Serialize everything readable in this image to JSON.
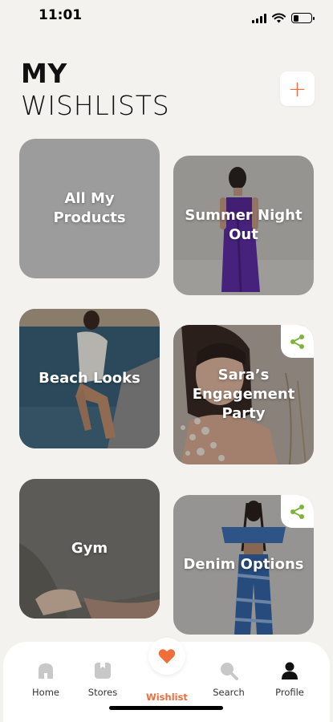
{
  "status": {
    "time": "11:01",
    "battery_level": 0.3
  },
  "header": {
    "title_line1": "MY",
    "title_line2": "WISHLISTS",
    "add_label": "+"
  },
  "cards": [
    {
      "label": "All My Products"
    },
    {
      "label": "Summer Night Out"
    },
    {
      "label": "Beach Looks"
    },
    {
      "label": "Sara’s Engagement Party"
    },
    {
      "label": "Gym"
    },
    {
      "label": "Denim Options"
    }
  ],
  "nav": {
    "home": "Home",
    "stores": "Stores",
    "wishlist": "Wishlist",
    "search": "Search",
    "profile": "Profile"
  },
  "colors": {
    "accent": "#ee6e3c",
    "share": "#7fb33e",
    "background": "#f4f2ef"
  }
}
